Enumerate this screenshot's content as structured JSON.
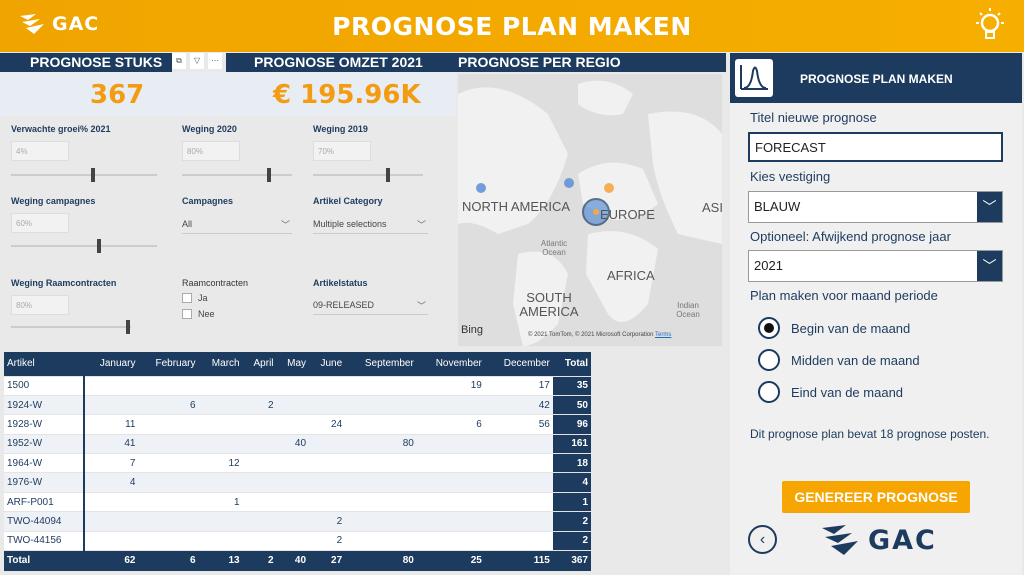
{
  "header": {
    "logo_text": "GAC",
    "title": "PROGNOSE PLAN MAKEN"
  },
  "sections": {
    "stuks": "PROGNOSE STUKS 2",
    "omzet": "PROGNOSE OMZET 2021",
    "regio": "PROGNOSE PER REGIO"
  },
  "kpis": {
    "stuks": "367",
    "omzet": "€ 195.96K"
  },
  "filters": {
    "groei": {
      "label": "Verwachte groei% 2021",
      "value": "4%",
      "level": 0.5
    },
    "w2020": {
      "label": "Weging 2020",
      "value": "80%",
      "level": 0.8
    },
    "w2019": {
      "label": "Weging 2019",
      "value": "70%",
      "level": 0.7
    },
    "wcamp": {
      "label": "Weging campagnes",
      "value": "60%",
      "level": 0.6
    },
    "campagnes": {
      "label": "Campagnes",
      "value": "All"
    },
    "artcat": {
      "label": "Artikel Category",
      "value": "Multiple selections"
    },
    "wraam": {
      "label": "Weging Raamcontracten",
      "value": "80%",
      "level": 0.8
    },
    "raam": {
      "label": "Raamcontracten",
      "options": [
        "Ja",
        "Nee"
      ]
    },
    "status": {
      "label": "Artikelstatus",
      "value": "09-RELEASED"
    }
  },
  "map": {
    "labels": [
      "NORTH AMERICA",
      "EUROPE",
      "ASI",
      "AFRICA",
      "SOUTH AMERICA"
    ],
    "oceans": [
      "Atlantic Ocean",
      "Indian Ocean"
    ],
    "provider": "Bing",
    "copyright": "© 2021 TomTom, © 2021 Microsoft Corporation",
    "terms": "Terms",
    "colors": {
      "bubble_blue": "#5b8fd6",
      "bubble_orange": "#f4a742"
    }
  },
  "matrix": {
    "headers": [
      "Artikel",
      "January",
      "February",
      "March",
      "April",
      "May",
      "June",
      "September",
      "November",
      "December",
      "Total"
    ],
    "rows": [
      [
        "1500",
        "",
        "",
        "",
        "",
        "",
        "",
        "",
        "19",
        "17",
        "35"
      ],
      [
        "1924-W",
        "",
        "6",
        "",
        "2",
        "",
        "",
        "",
        "",
        "42",
        "50"
      ],
      [
        "1928-W",
        "11",
        "",
        "",
        "",
        "",
        "24",
        "",
        "6",
        "56",
        "96"
      ],
      [
        "1952-W",
        "41",
        "",
        "",
        "",
        "40",
        "",
        "80",
        "",
        "",
        "161"
      ],
      [
        "1964-W",
        "7",
        "",
        "12",
        "",
        "",
        "",
        "",
        "",
        "",
        "18"
      ],
      [
        "1976-W",
        "4",
        "",
        "",
        "",
        "",
        "",
        "",
        "",
        "",
        "4"
      ],
      [
        "ARF-P001",
        "",
        "",
        "1",
        "",
        "",
        "",
        "",
        "",
        "",
        "1"
      ],
      [
        "TWO-44094",
        "",
        "",
        "",
        "",
        "",
        "2",
        "",
        "",
        "",
        "2"
      ],
      [
        "TWO-44156",
        "",
        "",
        "",
        "",
        "",
        "2",
        "",
        "",
        "",
        "2"
      ]
    ],
    "totals": [
      "Total",
      "62",
      "6",
      "13",
      "2",
      "40",
      "27",
      "80",
      "25",
      "115",
      "367"
    ]
  },
  "panel": {
    "title": "PROGNOSE PLAN MAKEN",
    "titel_label": "Titel nieuwe prognose",
    "titel_value": "FORECAST",
    "vestiging_label": "Kies vestiging",
    "vestiging_value": "BLAUW",
    "jaar_label": "Optioneel: Afwijkend prognose jaar",
    "jaar_value": "2021",
    "periode_label": "Plan maken voor maand periode",
    "radios": [
      "Begin van de maand",
      "Midden van de maand",
      "Eind van de maand"
    ],
    "selected_radio": 0,
    "info": "Dit prognose plan bevat 18 prognose posten.",
    "generate_label": "GENEREER PROGNOSE",
    "back_icon": "chevron-left-icon",
    "logo_text": "GAC"
  },
  "colors": {
    "navy": "#1d3b5e",
    "orange": "#f6a800",
    "kpi": "#f39c12"
  }
}
